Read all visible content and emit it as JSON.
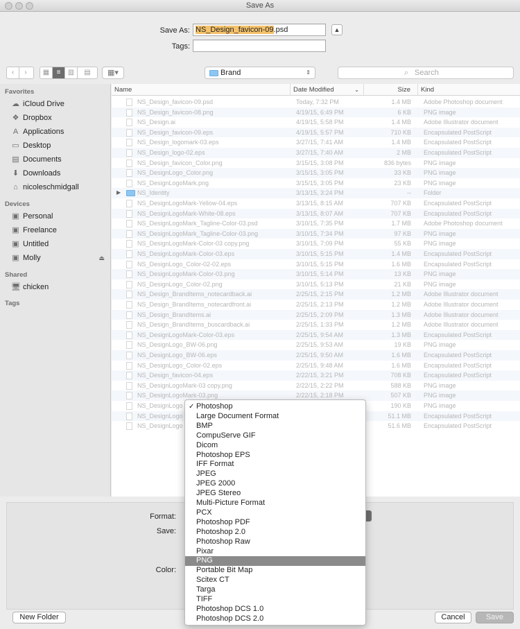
{
  "window": {
    "title": "Save As"
  },
  "save_as": {
    "label": "Save As:",
    "name_selected": "NS_Design_favicon-09",
    "extension": ".psd",
    "tags_label": "Tags:"
  },
  "toolbar": {
    "location": "Brand",
    "search_placeholder": "Search"
  },
  "sidebar": {
    "favorites_header": "Favorites",
    "favorites": [
      {
        "label": "iCloud Drive",
        "icon": "cloud-icon"
      },
      {
        "label": "Dropbox",
        "icon": "dropbox-icon"
      },
      {
        "label": "Applications",
        "icon": "applications-icon"
      },
      {
        "label": "Desktop",
        "icon": "desktop-icon"
      },
      {
        "label": "Documents",
        "icon": "documents-icon"
      },
      {
        "label": "Downloads",
        "icon": "downloads-icon"
      },
      {
        "label": "nicoleschmidgall",
        "icon": "home-icon"
      }
    ],
    "devices_header": "Devices",
    "devices": [
      {
        "label": "Personal",
        "icon": "drive-icon"
      },
      {
        "label": "Freelance",
        "icon": "drive-icon"
      },
      {
        "label": "Untitled",
        "icon": "drive-icon"
      },
      {
        "label": "Molly",
        "icon": "drive-icon"
      }
    ],
    "shared_header": "Shared",
    "shared": [
      {
        "label": "chicken",
        "icon": "computer-icon"
      }
    ],
    "tags_header": "Tags"
  },
  "columns": {
    "name": "Name",
    "date": "Date Modified",
    "size": "Size",
    "kind": "Kind"
  },
  "files": [
    {
      "name": "NS_Design_favicon-09.psd",
      "date": "Today, 7:32 PM",
      "size": "1.4 MB",
      "kind": "Adobe Photoshop document"
    },
    {
      "name": "NS_Design_favicon-08.png",
      "date": "4/19/15, 6:49 PM",
      "size": "6 KB",
      "kind": "PNG image"
    },
    {
      "name": "NS_Design.ai",
      "date": "4/19/15, 5:58 PM",
      "size": "1.4 MB",
      "kind": "Adobe Illustrator document"
    },
    {
      "name": "NS_Design_favicon-09.eps",
      "date": "4/19/15, 5:57 PM",
      "size": "710 KB",
      "kind": "Encapsulated PostScript"
    },
    {
      "name": "NS_Design_logomark-03.eps",
      "date": "3/27/15, 7:41 AM",
      "size": "1.4 MB",
      "kind": "Encapsulated PostScript"
    },
    {
      "name": "NS_Design_logo-02.eps",
      "date": "3/27/15, 7:40 AM",
      "size": "2 MB",
      "kind": "Encapsulated PostScript"
    },
    {
      "name": "NS_Design_favicon_Color.png",
      "date": "3/15/15, 3:08 PM",
      "size": "836 bytes",
      "kind": "PNG image"
    },
    {
      "name": "NS_DesignLogo_Color.png",
      "date": "3/15/15, 3:05 PM",
      "size": "33 KB",
      "kind": "PNG image"
    },
    {
      "name": "NS_DesignLogoMark.png",
      "date": "3/15/15, 3:05 PM",
      "size": "23 KB",
      "kind": "PNG image"
    },
    {
      "name": "NS_Identity",
      "date": "3/13/15, 3:24 PM",
      "size": "--",
      "kind": "Folder",
      "folder": true
    },
    {
      "name": "NS_DesignLogoMark-Yellow-04.eps",
      "date": "3/13/15, 8:15 AM",
      "size": "707 KB",
      "kind": "Encapsulated PostScript"
    },
    {
      "name": "NS_DesignLogoMark-White-08.eps",
      "date": "3/13/15, 8:07 AM",
      "size": "707 KB",
      "kind": "Encapsulated PostScript"
    },
    {
      "name": "NS_DesignLogoMark_Tagline-Color-03.psd",
      "date": "3/10/15, 7:35 PM",
      "size": "1.7 MB",
      "kind": "Adobe Photoshop document"
    },
    {
      "name": "NS_DesignLogoMark_Tagline-Color-03.png",
      "date": "3/10/15, 7:34 PM",
      "size": "97 KB",
      "kind": "PNG image"
    },
    {
      "name": "NS_DesignLogoMark-Color-03 copy.png",
      "date": "3/10/15, 7:09 PM",
      "size": "55 KB",
      "kind": "PNG image"
    },
    {
      "name": "NS_DesignLogoMark-Color-03.eps",
      "date": "3/10/15, 5:15 PM",
      "size": "1.4 MB",
      "kind": "Encapsulated PostScript"
    },
    {
      "name": "NS_DesignLogo_Color-02-02.eps",
      "date": "3/10/15, 5:15 PM",
      "size": "1.6 MB",
      "kind": "Encapsulated PostScript"
    },
    {
      "name": "NS_DesignLogoMark-Color-03.png",
      "date": "3/10/15, 5:14 PM",
      "size": "13 KB",
      "kind": "PNG image"
    },
    {
      "name": "NS_DesignLogo_Color-02.png",
      "date": "3/10/15, 5:13 PM",
      "size": "21 KB",
      "kind": "PNG image"
    },
    {
      "name": "NS_Design_BrandItems_notecardback.ai",
      "date": "2/25/15, 2:15 PM",
      "size": "1.2 MB",
      "kind": "Adobe Illustrator document"
    },
    {
      "name": "NS_Design_BrandItems_notecardfront.ai",
      "date": "2/25/15, 2:13 PM",
      "size": "1.2 MB",
      "kind": "Adobe Illustrator document"
    },
    {
      "name": "NS_Design_BrandItems.ai",
      "date": "2/25/15, 2:09 PM",
      "size": "1.3 MB",
      "kind": "Adobe Illustrator document"
    },
    {
      "name": "NS_Design_BrandItems_buscardback.ai",
      "date": "2/25/15, 1:33 PM",
      "size": "1.2 MB",
      "kind": "Adobe Illustrator document"
    },
    {
      "name": "NS_DesignLogoMark-Color-03.eps",
      "date": "2/25/15, 9:54 AM",
      "size": "1.3 MB",
      "kind": "Encapsulated PostScript"
    },
    {
      "name": "NS_DesignLogo_BW-06.png",
      "date": "2/25/15, 9:53 AM",
      "size": "19 KB",
      "kind": "PNG image"
    },
    {
      "name": "NS_DesignLogo_BW-06.eps",
      "date": "2/25/15, 9:50 AM",
      "size": "1.6 MB",
      "kind": "Encapsulated PostScript"
    },
    {
      "name": "NS_DesignLogo_Color-02.eps",
      "date": "2/25/15, 9:48 AM",
      "size": "1.6 MB",
      "kind": "Encapsulated PostScript"
    },
    {
      "name": "NS_Design_favicon-04.eps",
      "date": "2/22/15, 3:21 PM",
      "size": "708 KB",
      "kind": "Encapsulated PostScript"
    },
    {
      "name": "NS_DesignLogoMark-03 copy.png",
      "date": "2/22/15, 2:22 PM",
      "size": "588 KB",
      "kind": "PNG image"
    },
    {
      "name": "NS_DesignLogoMark-03.png",
      "date": "2/22/15, 2:18 PM",
      "size": "507 KB",
      "kind": "PNG image"
    },
    {
      "name": "NS_DesignLogo",
      "date": "",
      "size": "190 KB",
      "kind": "PNG image"
    },
    {
      "name": "NS_DesignLogo",
      "date": "",
      "size": "51.1 MB",
      "kind": "Encapsulated PostScript"
    },
    {
      "name": "NS_DesignLogo",
      "date": "",
      "size": "51.6 MB",
      "kind": "Encapsulated PostScript"
    }
  ],
  "format_panel": {
    "format_label": "Format:",
    "save_label": "Save:",
    "color_label": "Color:"
  },
  "format_menu": {
    "checked": "Photoshop",
    "highlighted": "PNG",
    "options": [
      "Photoshop",
      "Large Document Format",
      "BMP",
      "CompuServe GIF",
      "Dicom",
      "Photoshop EPS",
      "IFF Format",
      "JPEG",
      "JPEG 2000",
      "JPEG Stereo",
      "Multi-Picture Format",
      "PCX",
      "Photoshop PDF",
      "Photoshop 2.0",
      "Photoshop Raw",
      "Pixar",
      "PNG",
      "Portable Bit Map",
      "Scitex CT",
      "Targa",
      "TIFF",
      "Photoshop DCS 1.0",
      "Photoshop DCS 2.0"
    ]
  },
  "buttons": {
    "new_folder": "New Folder",
    "cancel": "Cancel",
    "save": "Save"
  }
}
